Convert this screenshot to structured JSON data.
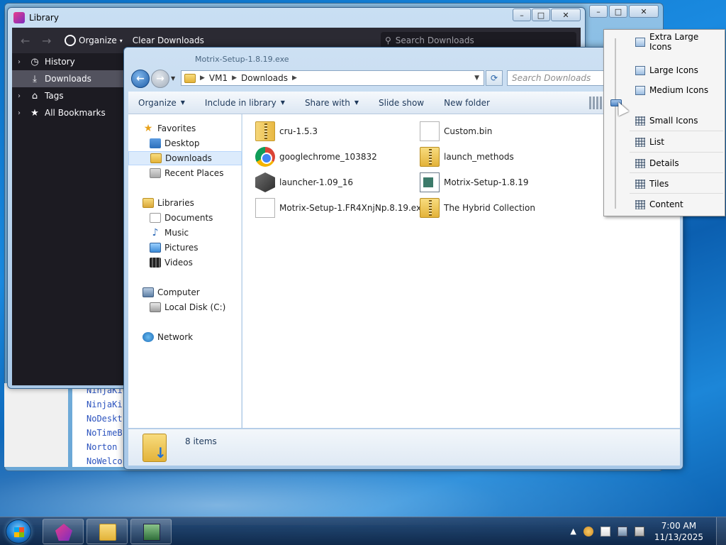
{
  "background_window": {
    "code_lines": [
      "NinjaKi",
      "NinjaKi",
      "NoDeskt",
      "NoTimeB",
      "Norton ",
      "NoWelco"
    ]
  },
  "library": {
    "title": "Library",
    "toolbar": {
      "organize_label": "Organize",
      "clear_label": "Clear Downloads",
      "search_placeholder": "Search Downloads"
    },
    "sidebar": [
      {
        "label": "History",
        "icon": "clock-icon"
      },
      {
        "label": "Downloads",
        "icon": "download-icon"
      },
      {
        "label": "Tags",
        "icon": "tag-icon"
      },
      {
        "label": "All Bookmarks",
        "icon": "star-icon"
      }
    ]
  },
  "explorer": {
    "title_hint": "Motrix-Setup-1.8.19.exe",
    "address": {
      "crumbs": [
        "VM1",
        "Downloads"
      ]
    },
    "search_placeholder": "Search Downloads",
    "commands": {
      "organize": "Organize",
      "include": "Include in library",
      "share": "Share with",
      "slideshow": "Slide show",
      "newfolder": "New folder"
    },
    "nav": {
      "favorites": "Favorites",
      "desktop": "Desktop",
      "downloads": "Downloads",
      "recent": "Recent Places",
      "libraries": "Libraries",
      "documents": "Documents",
      "music": "Music",
      "pictures": "Pictures",
      "videos": "Videos",
      "computer": "Computer",
      "localdisk": "Local Disk (C:)",
      "network": "Network"
    },
    "files": [
      {
        "name": "cru-1.5.3",
        "icon": "zip-folder-icon"
      },
      {
        "name": "Custom.bin",
        "icon": "blank-file-icon"
      },
      {
        "name": "googlechrome_103832",
        "icon": "chrome-icon"
      },
      {
        "name": "launch_methods",
        "icon": "zip-folder-icon"
      },
      {
        "name": "launcher-1.09_16",
        "icon": "minecraft-icon"
      },
      {
        "name": "Motrix-Setup-1.8.19",
        "icon": "setup-icon"
      },
      {
        "name": "Motrix-Setup-1.FR4XnjNp.8.19.ex...",
        "icon": "blank-file-icon"
      },
      {
        "name": "The Hybrid Collection",
        "icon": "zip-folder-icon"
      }
    ],
    "status": "8 items"
  },
  "view_menu": {
    "items": [
      "Extra Large Icons",
      "Large Icons",
      "Medium Icons",
      "Small Icons",
      "List",
      "Details",
      "Tiles",
      "Content"
    ]
  },
  "taskbar": {
    "time": "7:00 AM",
    "date": "11/13/2025"
  },
  "colors": {
    "accent": "#1a7ad0",
    "library_dark": "#1c1b22"
  }
}
